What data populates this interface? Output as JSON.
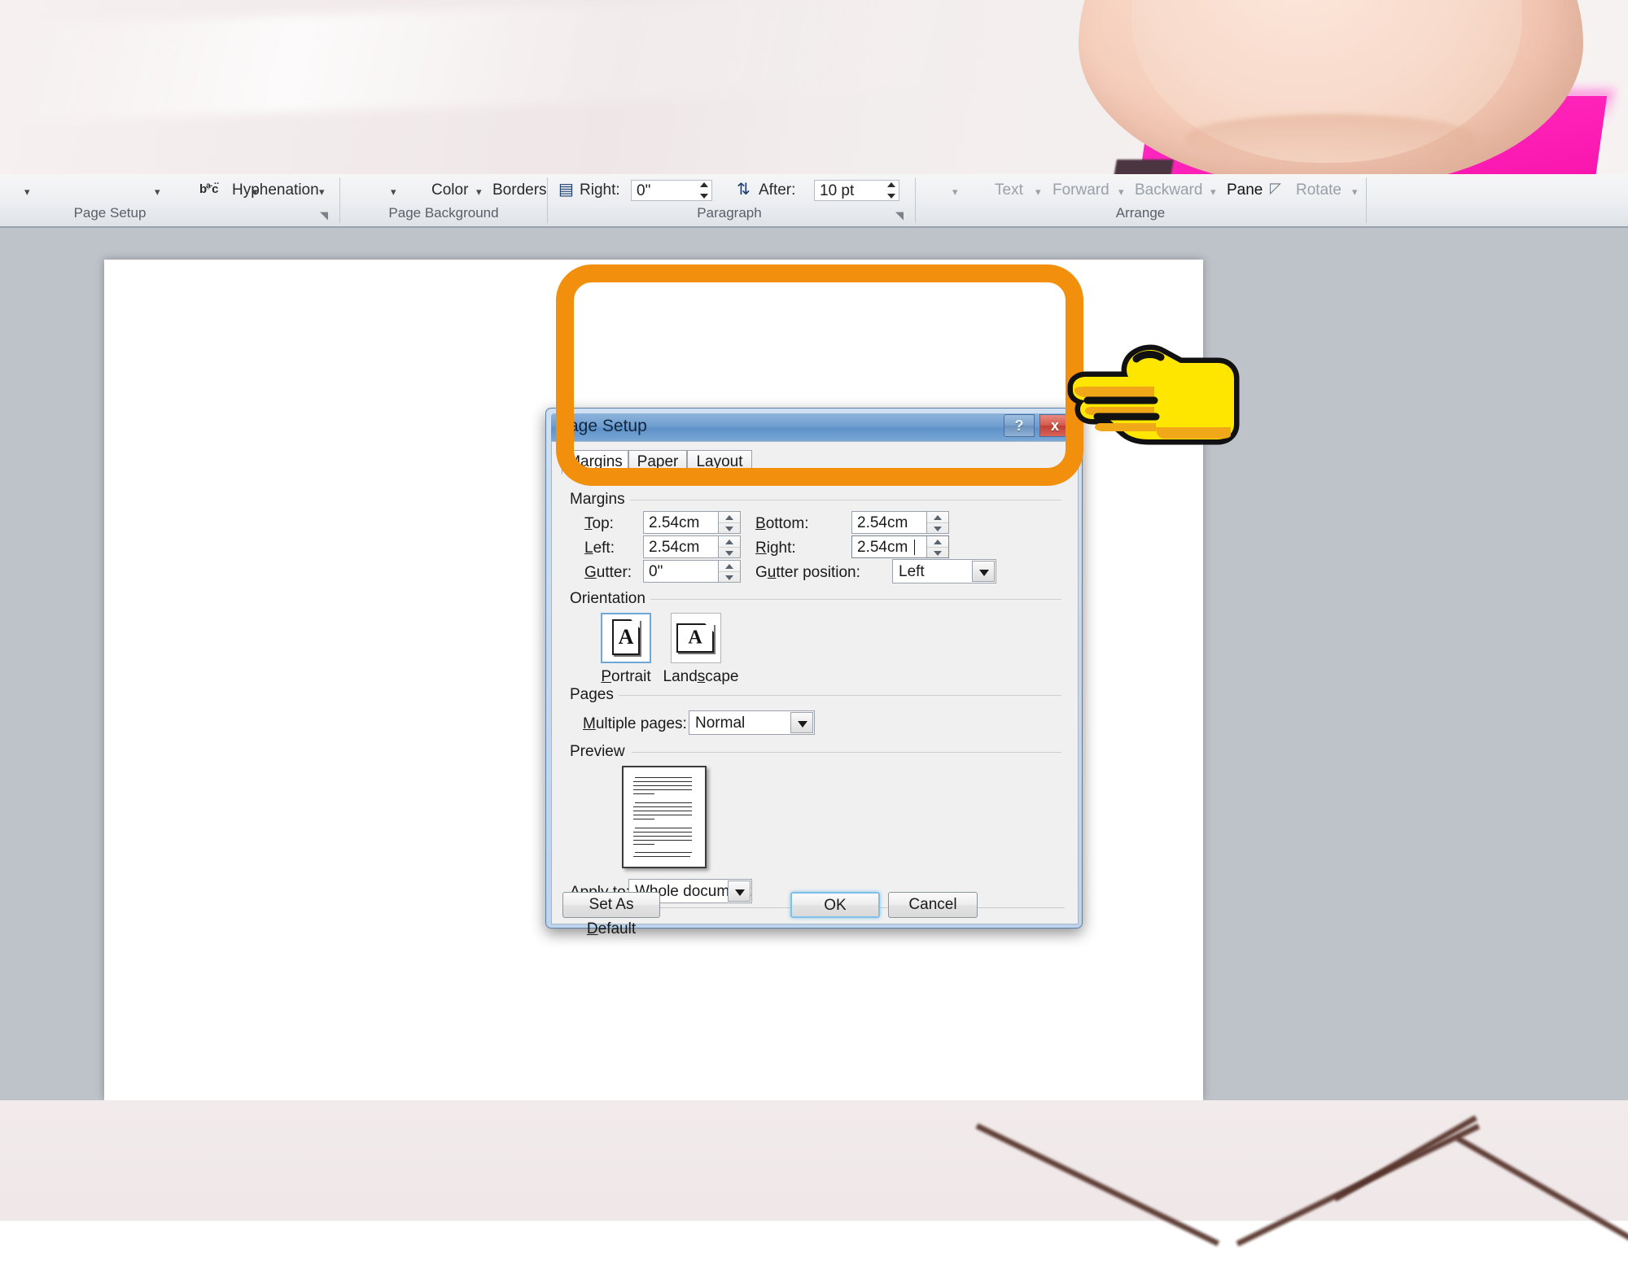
{
  "ribbon": {
    "groups": [
      {
        "label": "Page Setup"
      },
      {
        "label": "Page Background"
      },
      {
        "label": "Paragraph"
      },
      {
        "label": "Arrange"
      }
    ],
    "items": {
      "hyphenation": "Hyphenation",
      "hyphenation_icon": "hyphenation-icon",
      "color": "Color",
      "borders": "Borders",
      "indent_right_label": "Right:",
      "indent_right_value": "0\"",
      "spacing_after_label": "After:",
      "spacing_after_value": "10 pt",
      "text": "Text",
      "forward": "Forward",
      "backward": "Backward",
      "pane": "Pane",
      "rotate": "Rotate"
    }
  },
  "dialog": {
    "title": "Page Setup",
    "help_glyph": "?",
    "close_glyph": "x",
    "tabs": [
      {
        "label": "Margins",
        "active": true
      },
      {
        "label": "Paper",
        "active": false
      },
      {
        "label": "Layout",
        "active": false
      }
    ],
    "margins_section": {
      "title": "Margins",
      "fields": [
        {
          "label": "Top:",
          "accel": "T",
          "value": "2.54cm",
          "caret": false
        },
        {
          "label": "Bottom:",
          "accel": "B",
          "value": "2.54cm",
          "caret": false
        },
        {
          "label": "Left:",
          "accel": "L",
          "value": "2.54cm",
          "caret": false
        },
        {
          "label": "Right:",
          "accel": "R",
          "value": "2.54cm",
          "caret": true
        },
        {
          "label": "Gutter:",
          "accel": "G",
          "value": "0\"",
          "caret": false
        }
      ],
      "gutter_position_label": "Gutter position:",
      "gutter_position_accel": "u",
      "gutter_position_value": "Left"
    },
    "orientation_section": {
      "title": "Orientation",
      "portrait_label": "Portrait",
      "portrait_accel": "P",
      "landscape_label": "Landscape",
      "landscape_accel": "s",
      "selected": "Portrait",
      "glyph": "A"
    },
    "pages_section": {
      "title": "Pages",
      "multiple_pages_label": "Multiple pages:",
      "multiple_pages_accel": "M",
      "multiple_pages_value": "Normal"
    },
    "preview_section": {
      "title": "Preview",
      "apply_to_label": "Apply to:",
      "apply_to_accel": "y",
      "apply_to_value": "Whole document"
    },
    "buttons": {
      "set_as_default": "Set As Default",
      "set_as_default_accel": "D",
      "ok": "OK",
      "cancel": "Cancel"
    }
  },
  "annotations": {
    "highlight_color": "#f2900d",
    "hand_fill": "#ffe600",
    "hand_shadow": "#f0a818",
    "hand_outline": "#111111",
    "hand_name": "pointing-hand-left"
  },
  "colors": {
    "workspace": "#bdc3c9",
    "page": "#ffffff",
    "titlebar_blue": "#6f9ed0",
    "close_red": "#c8483a",
    "photo_pink": "#ff2ec6"
  }
}
